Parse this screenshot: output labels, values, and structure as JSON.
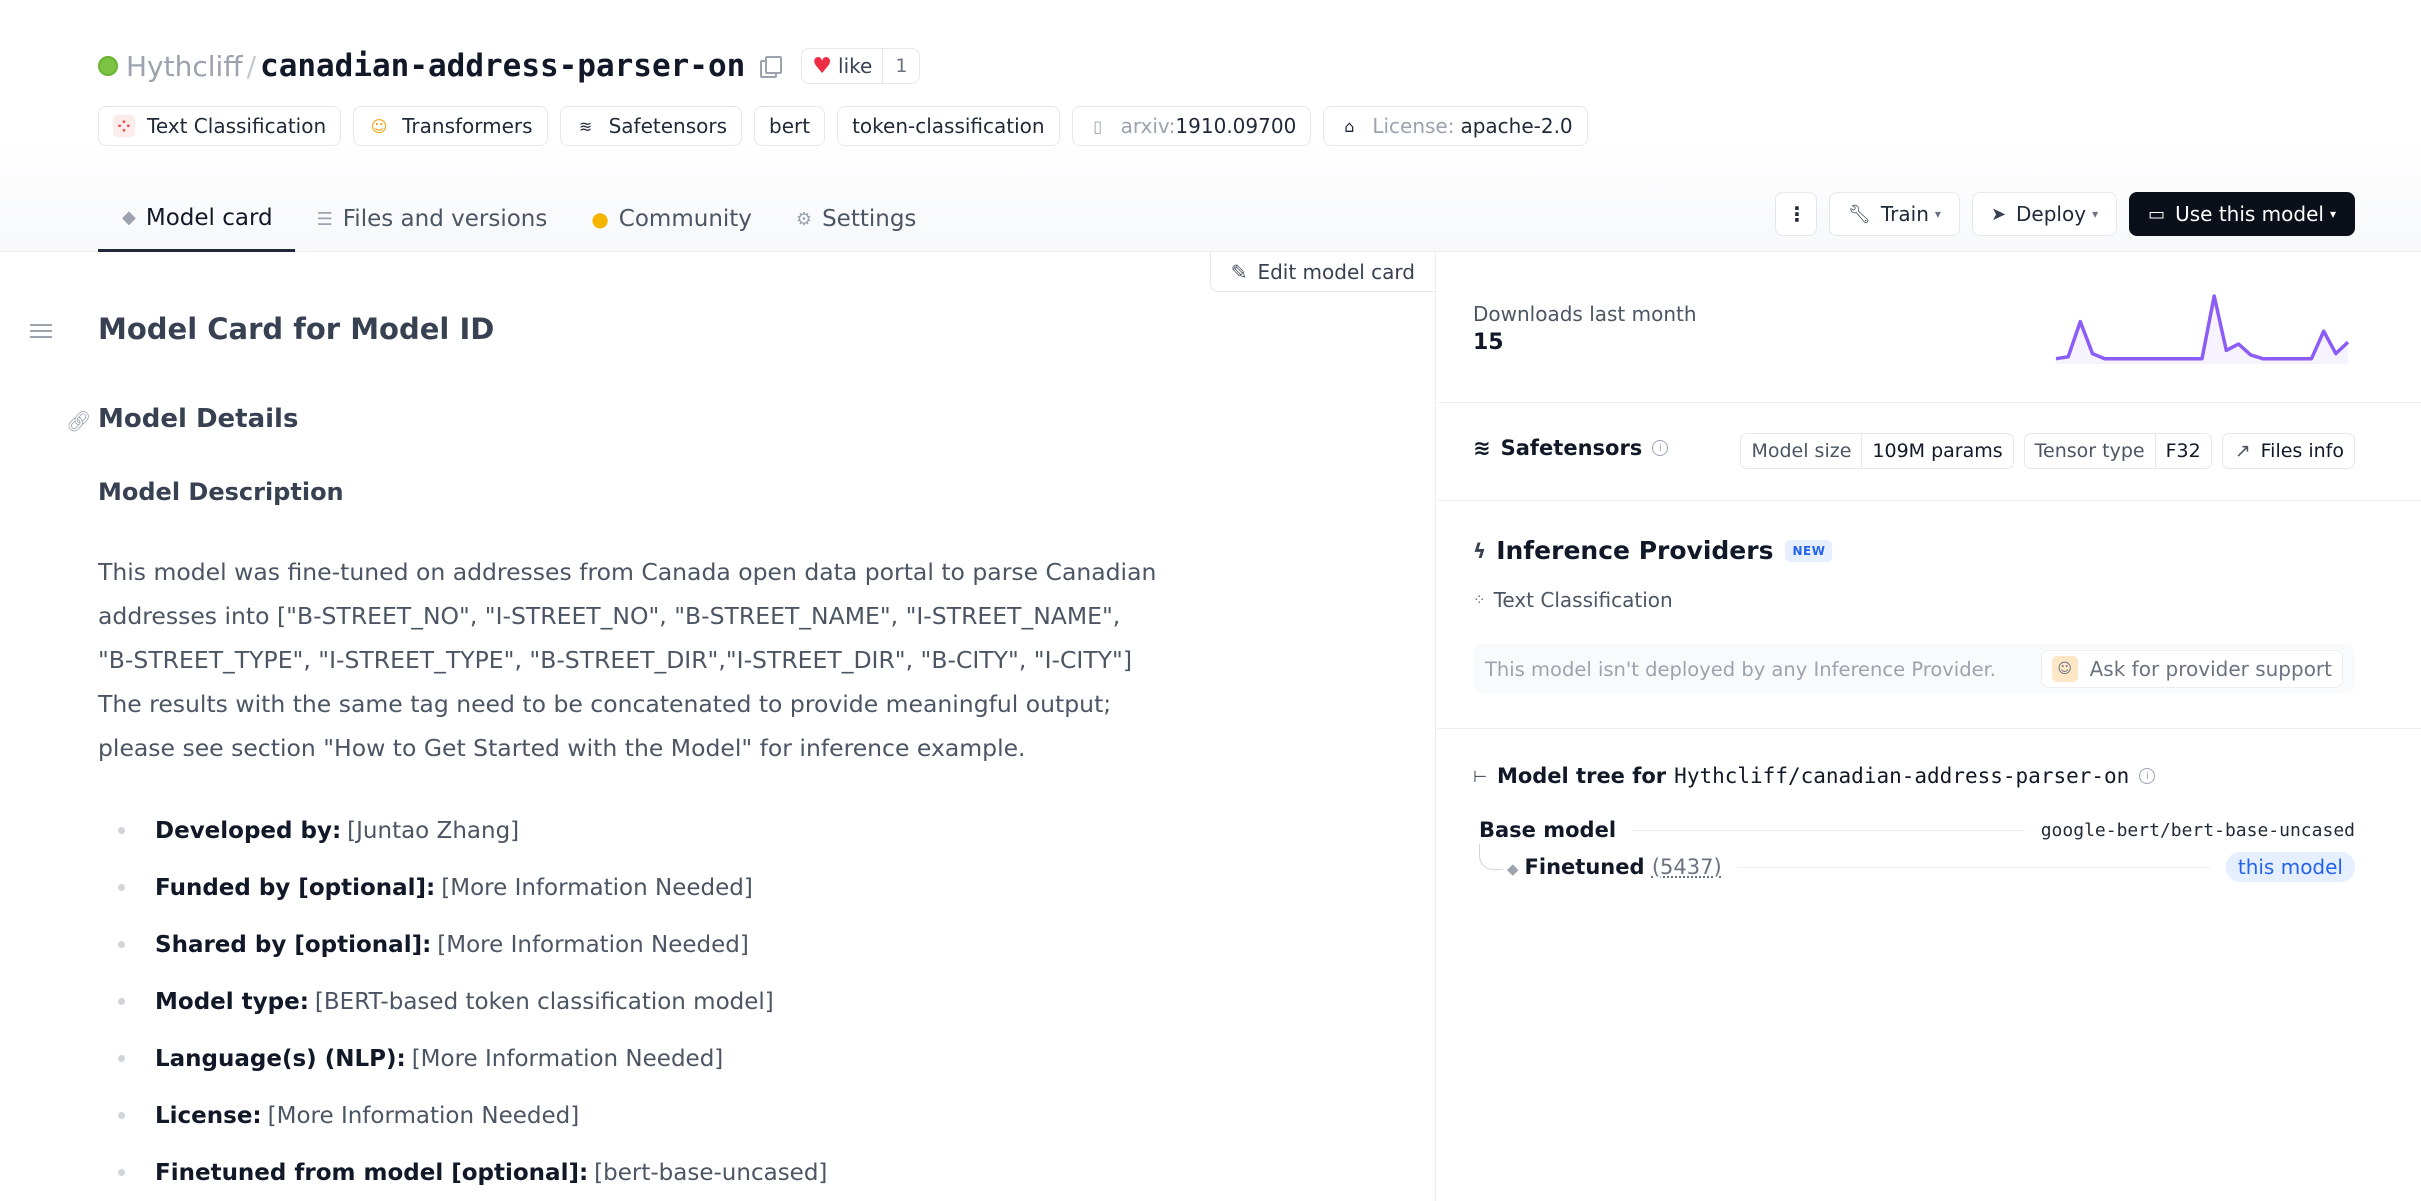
{
  "repo": {
    "owner": "Hythcliff",
    "name": "canadian-address-parser-on",
    "like_label": "like",
    "like_count": "1"
  },
  "tags": [
    {
      "label": "Text Classification",
      "icon": "text-classification-icon"
    },
    {
      "label": "Transformers",
      "icon": "transformers-icon"
    },
    {
      "label": "Safetensors",
      "icon": "safetensors-icon"
    },
    {
      "label": "bert"
    },
    {
      "label": "token-classification"
    },
    {
      "prefix": "arxiv:",
      "label": "1910.09700",
      "icon": "paper-icon"
    },
    {
      "prefix": "License:",
      "label": "apache-2.0",
      "icon": "license-icon"
    }
  ],
  "tabs": [
    {
      "label": "Model card",
      "active": true
    },
    {
      "label": "Files and versions"
    },
    {
      "label": "Community"
    },
    {
      "label": "Settings"
    }
  ],
  "actions": {
    "train": "Train",
    "deploy": "Deploy",
    "use": "Use this model"
  },
  "content": {
    "edit_label": "Edit model card",
    "h1": "Model Card for Model ID",
    "h2": "Model Details",
    "h3": "Model Description",
    "paragraph": "This model was fine-tuned on addresses from Canada open data portal to parse Canadian addresses into [\"B-STREET_NO\", \"I-STREET_NO\", \"B-STREET_NAME\", \"I-STREET_NAME\", \"B-STREET_TYPE\", \"I-STREET_TYPE\", \"B-STREET_DIR\",\"I-STREET_DIR\", \"B-CITY\", \"I-CITY\"] The results with the same tag need to be concatenated to provide meaningful output; please see section \"How to Get Started with the Model\" for inference example.",
    "details": [
      {
        "key": "Developed by:",
        "value": "[Juntao Zhang]"
      },
      {
        "key": "Funded by [optional]:",
        "value": "[More Information Needed]"
      },
      {
        "key": "Shared by [optional]:",
        "value": "[More Information Needed]"
      },
      {
        "key": "Model type:",
        "value": "[BERT-based token classification model]"
      },
      {
        "key": "Language(s) (NLP):",
        "value": "[More Information Needed]"
      },
      {
        "key": "License:",
        "value": "[More Information Needed]"
      },
      {
        "key": "Finetuned from model [optional]:",
        "value": "[bert-base-uncased]"
      }
    ]
  },
  "sidebar": {
    "downloads_label": "Downloads last month",
    "downloads_value": "15",
    "sparkline": [
      0.02,
      0.05,
      0.6,
      0.1,
      0.02,
      0.02,
      0.02,
      0.02,
      0.02,
      0.02,
      0.02,
      0.02,
      0.02,
      1.0,
      0.15,
      0.25,
      0.08,
      0.02,
      0.02,
      0.02,
      0.02,
      0.02,
      0.45,
      0.1,
      0.28
    ],
    "sparkline_color": "#8b5cf6",
    "safetensors_label": "Safetensors",
    "model_size_key": "Model size",
    "model_size_value": "109M params",
    "tensor_type_key": "Tensor type",
    "tensor_type_value": "F32",
    "files_info": "Files info",
    "inference_title": "Inference Providers",
    "new_badge": "NEW",
    "inference_task": "Text Classification",
    "not_deployed": "This model isn't deployed by any Inference Provider.",
    "ask_support": "Ask for provider support",
    "tree_title": "Model tree for",
    "tree_repo": "Hythcliff/canadian-address-parser-on",
    "base_model_label": "Base model",
    "base_model_value": "google-bert/bert-base-uncased",
    "finetuned_label": "Finetuned",
    "finetuned_count": "(5437)",
    "this_model": "this model"
  }
}
